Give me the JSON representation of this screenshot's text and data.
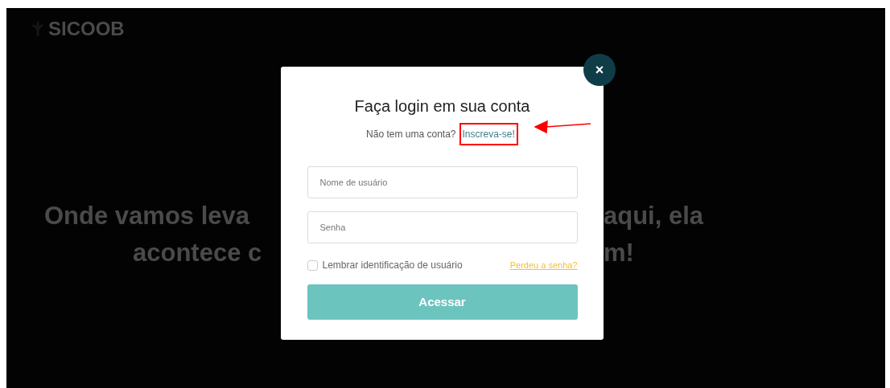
{
  "background_page": {
    "logo": "SICOOB",
    "headline_fragments": [
      "Onde vamos leva",
      "aqui, ela",
      "acontece c",
      "m!"
    ]
  },
  "login_dialog": {
    "close": "×",
    "title": "Faça login em sua conta",
    "signup_prompt": "Não tem uma conta?",
    "signup_link": "Inscreva-se!",
    "fields": [
      {
        "placeholder": "Nome de usuário"
      },
      {
        "placeholder": "Senha"
      }
    ],
    "remember": {
      "label": "Lembrar identificação de usuário",
      "checked": false
    },
    "forgot_link": "Perdeu a senha?",
    "submit": "Acessar"
  }
}
